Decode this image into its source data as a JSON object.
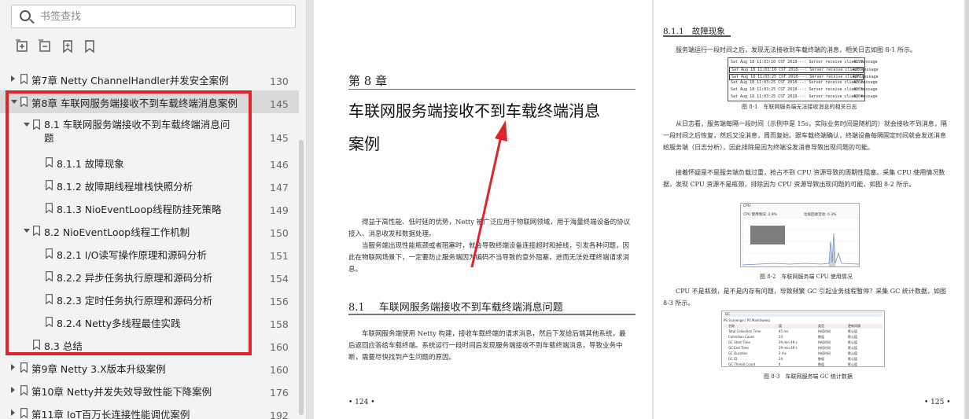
{
  "search": {
    "placeholder": "书签查找"
  },
  "toolbar_icons": [
    "expand-all-icon",
    "collapse-all-icon",
    "add-bookmark-icon",
    "bookmark-icon"
  ],
  "tree": [
    {
      "label": "第7章 Netty ChannelHandler并发安全案例",
      "page": "130",
      "level": 0,
      "expanded": false
    },
    {
      "label": "第8章 车联网服务端接收不到车载终端消息案例",
      "page": "145",
      "level": 0,
      "expanded": true,
      "selected": true
    },
    {
      "label": "8.1 车联网服务端接收不到车载终端消息问题",
      "page": "145",
      "level": 1,
      "expanded": true
    },
    {
      "label": "8.1.1 故障现象",
      "page": "146",
      "level": 2
    },
    {
      "label": "8.1.2 故障期线程堆栈快照分析",
      "page": "147",
      "level": 2
    },
    {
      "label": "8.1.3 NioEventLoop线程防挂死策略",
      "page": "149",
      "level": 2
    },
    {
      "label": "8.2 NioEventLoop线程工作机制",
      "page": "150",
      "level": 1,
      "expanded": true
    },
    {
      "label": "8.2.1 I/O读写操作原理和源码分析",
      "page": "151",
      "level": 2
    },
    {
      "label": "8.2.2 异步任务执行原理和源码分析",
      "page": "154",
      "level": 2
    },
    {
      "label": "8.2.3 定时任务执行原理和源码分析",
      "page": "156",
      "level": 2
    },
    {
      "label": "8.2.4 Netty多线程最佳实践",
      "page": "158",
      "level": 2
    },
    {
      "label": "8.3 总结",
      "page": "160",
      "level": 1
    },
    {
      "label": "第9章 Netty 3.X版本升级案例",
      "page": "160",
      "level": 0,
      "expanded": false
    },
    {
      "label": "第10章 Netty并发失效导致性能下降案例",
      "page": "176",
      "level": 0,
      "expanded": false
    },
    {
      "label": "第11章 IoT百万长连接性能调优案例",
      "page": "192",
      "level": 0,
      "expanded": false
    }
  ],
  "left_page": {
    "chapter_no": "第 8 章",
    "chapter_title_1": "车联网服务端接收不到车载终端消息",
    "chapter_title_2": "案例",
    "para1": "得益于高性能、低时延的优势，Netty 被广泛应用于物联网领域，用于海量终端设备的协议接入、消息收发和数据处理。",
    "para2": "当服务端出现性能瓶颈或者阻塞时，就会导致终端设备连接超时和掉线，引发各种问题，因此在物联网场景下，一定要防止服务端因为编码不当导致的意外阻塞，进而无法处理终端请求消息。",
    "section_no": "8.1",
    "section_title": "车联网服务端接收不到车载终端消息问题",
    "para3": "车联网服务端使用 Netty 构建，接收车载终端的请求消息，然后下发给后端其他系统，最后返回应答给车载终端。系统运行一段时间后发现服务端接收不到车载终端消息，导致业务中断，需要尽快找到产生问题的原因。",
    "folio": "• 124 •"
  },
  "right_page": {
    "subsection_no": "8.1.1",
    "subsection_title": "故障现象",
    "para1": "服务端运行一段时间之后，发现无法接收到车载终端的消息，相关日志如图 8-1 所示。",
    "log_lines": [
      {
        "text": "Sat Aug 18 11:03:10 CST 2018---: Server receive client message",
        "page": "4199"
      },
      {
        "text": "Sat Aug 18 11:03:10 CST 2018---: Server receive client message",
        "page": "4200"
      },
      {
        "text": "Sat Aug 18 11:03:25 CST 2018---: Server receive client message",
        "page": "4201"
      },
      {
        "text": "Sat Aug 18 11:03:25 CST 2018---: Server receive client message",
        "page": "4202"
      },
      {
        "text": "Sat Aug 18 11:03:25 CST 2018---: Server receive client message",
        "page": "4203"
      },
      {
        "text": "Sat Aug 18 11:03:25 CST 2018---: Server receive client message",
        "page": "4204"
      }
    ],
    "fig1_caption": "图 8-1　车联网服务端无法接收消息的相关日志",
    "para2": "从日志看，服务端每隔一段时间（示例中是 15s，实际业务时间是随机的）就会接收不到消息，隔一段时间之后恢复，然后又没消息，周而复始。跟车载终端确认，终端设备每隔固定时间就会发送消息给服务端（日志分析），因此排除是因为终端没发消息导致出现问题的可能。",
    "para3": "接着怀疑是不是服务端负载过重，抢占不到 CPU 资源导致的周期性阻塞。采集 CPU 使用情况数据，发现 CPU 资源不是瓶颈，排除因为 CPU 资源导致出现问题的可能，如图 8-2 所示。",
    "cpu_fig": {
      "title": "CPU",
      "used_label": "CPU 使用情况: 2.9%",
      "gc_label": "垃圾回收活动: 0.3%"
    },
    "fig2_caption": "图 8-2　车联网服务端 CPU 使用情况",
    "para4": "CPU 不是瓶颈，是不是内存有问题，导致频繁 GC 引起业务线程暂停？采集 GC 统计数据，如图 8-3 所示。",
    "gc_fig": {
      "title": "GC",
      "tab": "PS Scavenge / PS MarkSweep",
      "headers": [
        "名称",
        "值",
        "类型",
        "更新间隔"
      ],
      "rows": [
        [
          "Total Collection Time",
          "45 ms",
          "持续时间",
          "默认值"
        ],
        [
          "Collection Count",
          "24",
          "数值",
          "默认值"
        ],
        [
          "GC Start Time",
          "29 min 49 s",
          "持续时间",
          "默认值"
        ],
        [
          "GC End Time",
          "29 min 49 s",
          "持续时间",
          "默认值"
        ],
        [
          "GC Duration",
          "2 ms",
          "持续时间",
          "默认值"
        ],
        [
          "GC ID",
          "24",
          "数值",
          "默认值"
        ],
        [
          "GC Thread Count",
          "4",
          "数值",
          "默认值"
        ]
      ]
    },
    "fig3_caption": "图 8-3　车联网服务端 GC 统计数据",
    "folio": "• 125 •"
  }
}
